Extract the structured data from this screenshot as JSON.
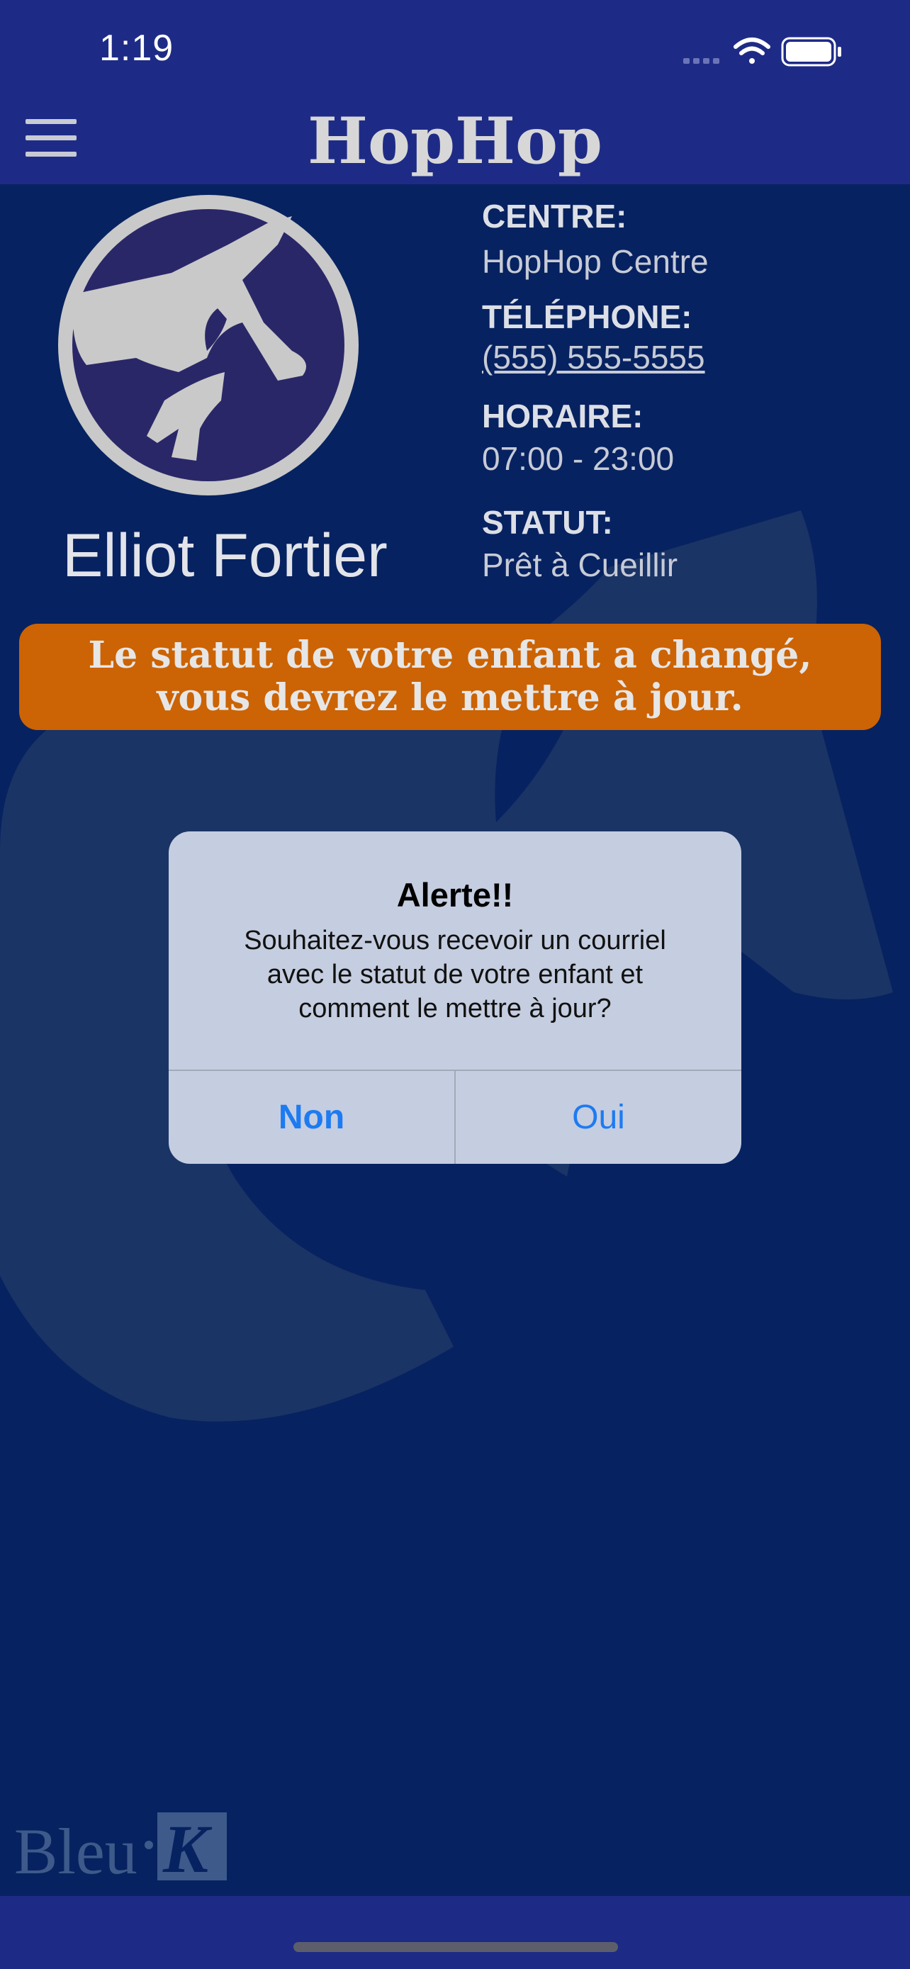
{
  "status_bar": {
    "time": "1:19",
    "icons": [
      "cellular-signal-icon",
      "wifi-icon",
      "battery-icon"
    ]
  },
  "header": {
    "title": "HopHop",
    "menu_icon": "hamburger-menu-icon"
  },
  "profile": {
    "name": "Elliot Fortier",
    "avatar_icon": "horse-logo-icon"
  },
  "info": {
    "centre_label": "CENTRE:",
    "centre_value": "HopHop Centre",
    "phone_label": "TÉLÉPHONE:",
    "phone_value": "(555) 555-5555",
    "hours_label": "HORAIRE:",
    "hours_value": "07:00 - 23:00",
    "status_label": "STATUT:",
    "status_value": "Prêt à Cueillir"
  },
  "banner": {
    "line1": "Le statut de votre enfant a changé,",
    "line2": "vous devrez le mettre à jour."
  },
  "dialog": {
    "title": "Alerte!!",
    "message_line1": "Souhaitez-vous recevoir un courriel",
    "message_line2": "avec le statut de votre enfant et",
    "message_line3": "comment le mettre à jour?",
    "no_label": "Non",
    "yes_label": "Oui"
  },
  "footer": {
    "brand_text": "Bleu",
    "brand_mark": "K"
  },
  "colors": {
    "background": "#072260",
    "bar": "#1e2b86",
    "banner": "#cc6304",
    "dialog": "#c5cde0",
    "button_text": "#1d7bf2"
  }
}
